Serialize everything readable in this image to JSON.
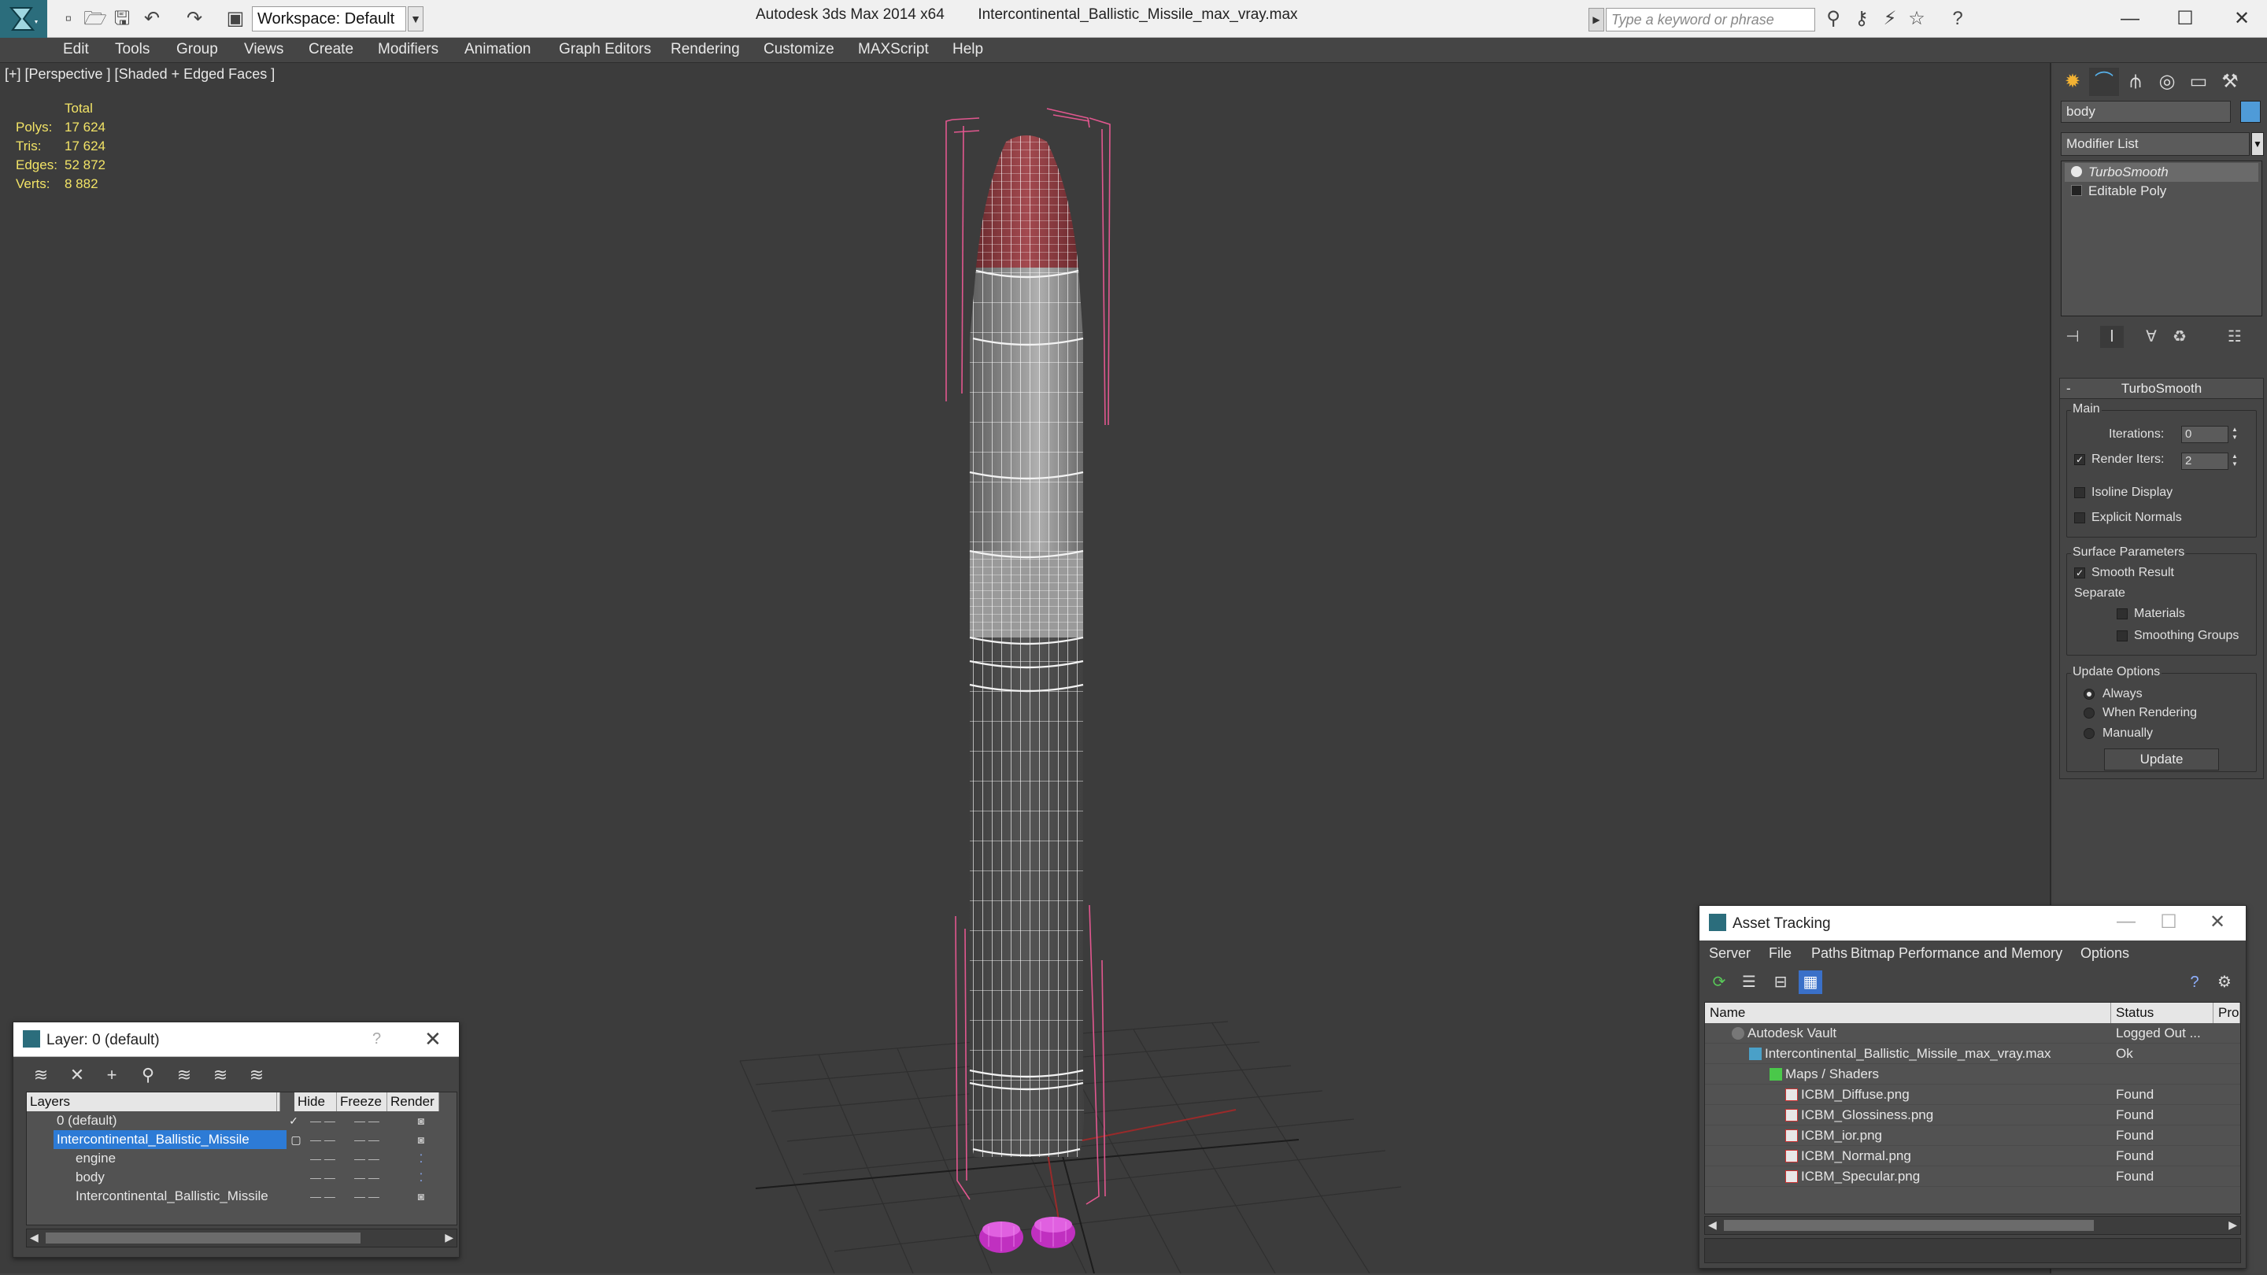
{
  "titlebar": {
    "workspace_value": "Workspace: Default",
    "app_name": "Autodesk 3ds Max 2014 x64",
    "file_name": "Intercontinental_Ballistic_Missile_max_vray.max",
    "search_placeholder": "Type a keyword or phrase"
  },
  "menu": [
    "Edit",
    "Tools",
    "Group",
    "Views",
    "Create",
    "Modifiers",
    "Animation",
    "Graph Editors",
    "Rendering",
    "Customize",
    "MAXScript",
    "Help"
  ],
  "viewport": {
    "label": "[+] [Perspective ] [Shaded + Edged Faces ]",
    "stats": {
      "header": "Total",
      "rows": [
        {
          "label": "Polys:",
          "value": "17 624"
        },
        {
          "label": "Tris:",
          "value": "17 624"
        },
        {
          "label": "Edges:",
          "value": "52 872"
        },
        {
          "label": "Verts:",
          "value": "8 882"
        }
      ]
    }
  },
  "command_panel": {
    "object_name": "body",
    "object_color": "#4f9bd8",
    "modifier_list": "Modifier List",
    "stack": [
      "TurboSmooth",
      "Editable Poly"
    ],
    "rollout_title": "TurboSmooth",
    "main_group": "Main",
    "iterations_label": "Iterations:",
    "iterations_value": "0",
    "render_iters_label": "Render Iters:",
    "render_iters_value": "2",
    "isoline_label": "Isoline Display",
    "explicit_normals_label": "Explicit Normals",
    "surface_group": "Surface Parameters",
    "smooth_result_label": "Smooth Result",
    "separate_label": "Separate",
    "materials_label": "Materials",
    "smoothing_groups_label": "Smoothing Groups",
    "update_group": "Update Options",
    "always_label": "Always",
    "when_rendering_label": "When Rendering",
    "manually_label": "Manually",
    "update_button": "Update"
  },
  "layer_dialog": {
    "title": "Layer: 0 (default)",
    "help": "?",
    "columns": [
      "Layers",
      "Hide",
      "Freeze",
      "Render"
    ],
    "rows": [
      {
        "name": "0 (default)"
      },
      {
        "name": "Intercontinental_Ballistic_Missile"
      },
      {
        "name": "engine"
      },
      {
        "name": "body"
      },
      {
        "name": "Intercontinental_Ballistic_Missile"
      }
    ]
  },
  "asset_dialog": {
    "title": "Asset Tracking",
    "menu": [
      "Server",
      "File",
      "Paths",
      "Bitmap Performance and Memory",
      "Options"
    ],
    "columns": [
      "Name",
      "Status",
      "Pro"
    ],
    "rows": [
      {
        "name": "Autodesk Vault",
        "status": "Logged Out ..."
      },
      {
        "name": "Intercontinental_Ballistic_Missile_max_vray.max",
        "status": "Ok"
      },
      {
        "name": "Maps / Shaders",
        "status": ""
      },
      {
        "name": "ICBM_Diffuse.png",
        "status": "Found"
      },
      {
        "name": "ICBM_Glossiness.png",
        "status": "Found"
      },
      {
        "name": "ICBM_ior.png",
        "status": "Found"
      },
      {
        "name": "ICBM_Normal.png",
        "status": "Found"
      },
      {
        "name": "ICBM_Specular.png",
        "status": "Found"
      }
    ]
  }
}
